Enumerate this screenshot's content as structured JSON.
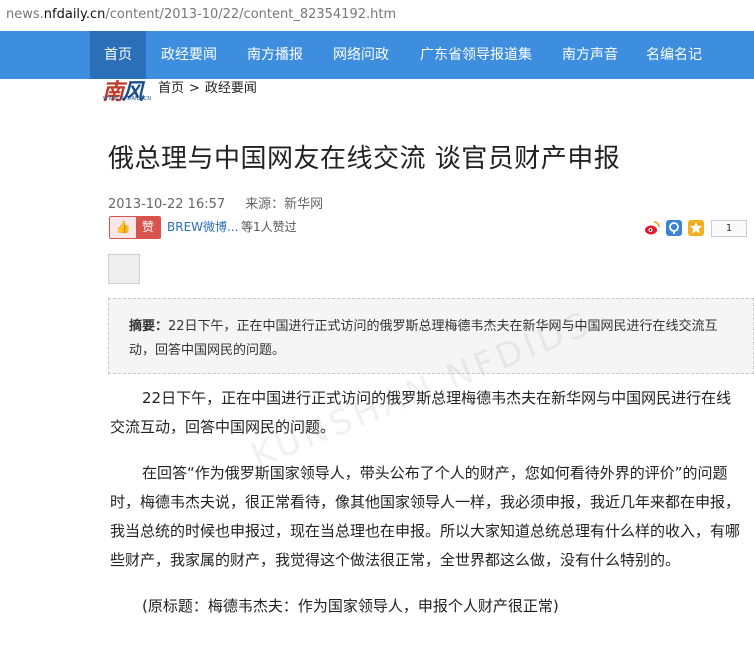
{
  "browser": {
    "url_prefix": "news.",
    "url_domain": "nfdaily.cn",
    "url_path": "/content/2013-10/22/content_82354192.htm"
  },
  "nav": {
    "items": [
      {
        "label": "首页",
        "active": true
      },
      {
        "label": "政经要闻"
      },
      {
        "label": "南方播报"
      },
      {
        "label": "网络问政"
      },
      {
        "label": "广东省领导报道集"
      },
      {
        "label": "南方声音"
      },
      {
        "label": "名编名记"
      }
    ]
  },
  "logo": {
    "text_a": "南",
    "text_b": "风",
    "subtext": "WWW.NFDAILY.CN"
  },
  "breadcrumb": {
    "home": "首页",
    "separator": ">",
    "section": "政经要闻"
  },
  "article": {
    "title": "俄总理与中国网友在线交流 谈官员财产申报",
    "datetime": "2013-10-22 16:57",
    "source_label": "来源：",
    "source": "新华网",
    "like": {
      "label": "赞",
      "weibo_text": "BREW微博...",
      "count_text": "等1人赞过"
    },
    "share_count": "1",
    "summary_label": "摘要：",
    "summary_text": "22日下午，正在中国进行正式访问的俄罗斯总理梅德韦杰夫在新华网与中国网民进行在线交流互动，回答中国网民的问题。",
    "paragraphs": [
      "22日下午，正在中国进行正式访问的俄罗斯总理梅德韦杰夫在新华网与中国网民进行在线交流互动，回答中国网民的问题。",
      "在回答“作为俄罗斯国家领导人，带头公布了个人的财产，您如何看待外界的评价”的问题时，梅德韦杰夫说，很正常看待，像其他国家领导人一样，我必须申报，我近几年来都在申报，我当总统的时候也申报过，现在当总理也在申报。所以大家知道总统总理有什么样的收入，有哪些财产，我家属的财产，我觉得这个做法很正常，全世界都这么做，没有什么特别的。",
      "(原标题：梅德韦杰夫：作为国家领导人，申报个人财产很正常)"
    ]
  },
  "watermark": "KUNSHAN.NFDIDS"
}
